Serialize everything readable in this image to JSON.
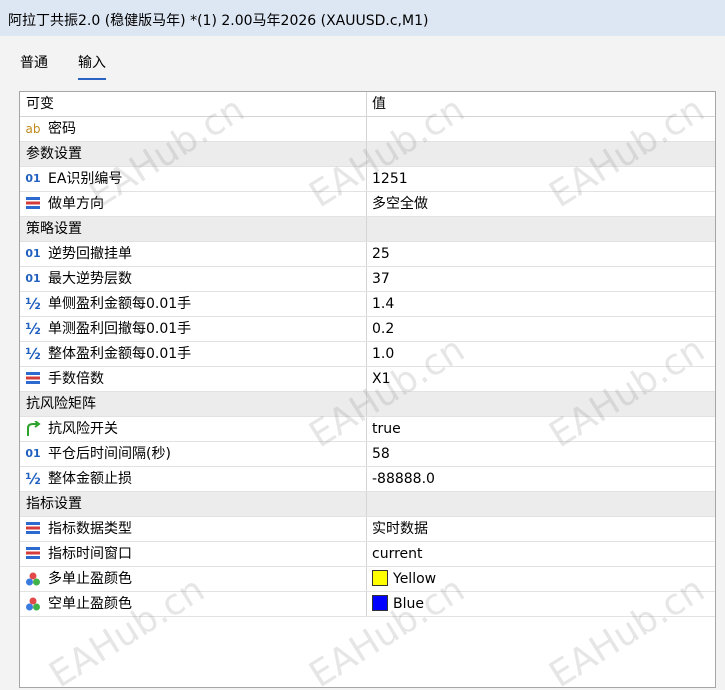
{
  "window": {
    "title": "阿拉丁共振2.0  (稳健版马年)   *(1) 2.00马年2026 (XAUUSD.c,M1)"
  },
  "tabs": [
    {
      "label": "普通"
    },
    {
      "label": "输入"
    }
  ],
  "table": {
    "headers": {
      "name": "可变",
      "value": "值"
    },
    "rows": [
      {
        "type": "param",
        "icon": "text-ab-icon",
        "name": "密码",
        "value": ""
      },
      {
        "type": "group",
        "name": "参数设置"
      },
      {
        "type": "param",
        "icon": "integer-01-icon",
        "name": "EA识别编号",
        "value": "1251"
      },
      {
        "type": "param",
        "icon": "enum-list-icon",
        "name": "做单方向",
        "value": "多空全做"
      },
      {
        "type": "group",
        "name": "策略设置"
      },
      {
        "type": "param",
        "icon": "integer-01-icon",
        "name": "逆势回撤挂单",
        "value": "25"
      },
      {
        "type": "param",
        "icon": "integer-01-icon",
        "name": "最大逆势层数",
        "value": "37"
      },
      {
        "type": "param",
        "icon": "double-half-icon",
        "name": "单侧盈利金额每0.01手",
        "value": "1.4"
      },
      {
        "type": "param",
        "icon": "double-half-icon",
        "name": "单测盈利回撤每0.01手",
        "value": "0.2"
      },
      {
        "type": "param",
        "icon": "double-half-icon",
        "name": "整体盈利金额每0.01手",
        "value": "1.0"
      },
      {
        "type": "param",
        "icon": "enum-list-icon",
        "name": "手数倍数",
        "value": "X1"
      },
      {
        "type": "group",
        "name": "抗风险矩阵"
      },
      {
        "type": "param",
        "icon": "bool-arrow-icon",
        "name": "抗风险开关",
        "value": "true"
      },
      {
        "type": "param",
        "icon": "integer-01-icon",
        "name": "平仓后时间间隔(秒)",
        "value": "58"
      },
      {
        "type": "param",
        "icon": "double-half-icon",
        "name": "整体金额止损",
        "value": "-88888.0"
      },
      {
        "type": "group",
        "name": "指标设置"
      },
      {
        "type": "param",
        "icon": "enum-list-icon",
        "name": "指标数据类型",
        "value": "实时数据"
      },
      {
        "type": "param",
        "icon": "enum-list-icon",
        "name": "指标时间窗口",
        "value": "current"
      },
      {
        "type": "param",
        "icon": "color-circles-icon",
        "name": "多单止盈颜色",
        "value": "Yellow",
        "swatch": "#ffff00"
      },
      {
        "type": "param",
        "icon": "color-circles-icon",
        "name": "空单止盈颜色",
        "value": "Blue",
        "swatch": "#0000ff"
      }
    ]
  },
  "watermark": "EAHub.cn",
  "colors": {
    "titlebar": "#dde6f3",
    "group_row": "#ececec",
    "accent": "#2b63c4"
  }
}
